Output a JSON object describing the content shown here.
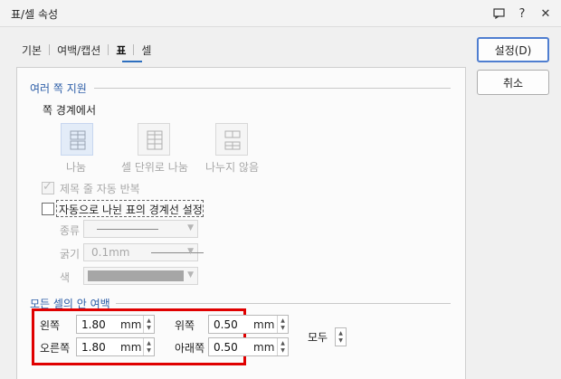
{
  "window": {
    "title": "표/셀 속성"
  },
  "titlebar_icons": [
    "comment-icon",
    "help-icon",
    "close-icon"
  ],
  "titlebar_glyphs": {
    "comment": "▭",
    "help": "?",
    "close": "✕"
  },
  "tabs": [
    {
      "label": "기본"
    },
    {
      "label": "여백/캡션"
    },
    {
      "label": "표",
      "active": true
    },
    {
      "label": "셀"
    }
  ],
  "buttons": {
    "ok": "설정(D)",
    "cancel": "취소"
  },
  "multi_page": {
    "title": "여러 쪽 지원",
    "boundary_label": "쪽 경계에서",
    "options": [
      {
        "label": "나눔",
        "selected": true
      },
      {
        "label": "셀 단위로 나눔"
      },
      {
        "label": "나누지 않음"
      }
    ],
    "repeat_header": {
      "label": "제목 줄 자동 반복",
      "checked": true,
      "enabled": false
    },
    "auto_border": {
      "label": "자동으로 나뉜 표의 경계선 설정",
      "checked": false
    },
    "type_label": "종류",
    "thickness_label": "굵기",
    "thickness_value": "0.1mm",
    "color_label": "색"
  },
  "cell_margin": {
    "title": "모든 셀의 안 여백",
    "left": {
      "label": "왼쪽",
      "value": "1.80",
      "unit": "mm"
    },
    "right": {
      "label": "오른쪽",
      "value": "1.80",
      "unit": "mm"
    },
    "top": {
      "label": "위쪽",
      "value": "0.50",
      "unit": "mm"
    },
    "bottom": {
      "label": "아래쪽",
      "value": "0.50",
      "unit": "mm"
    },
    "all_label": "모두"
  },
  "colors": {
    "accent": "#2e5fa8",
    "highlight": "#e00000"
  }
}
